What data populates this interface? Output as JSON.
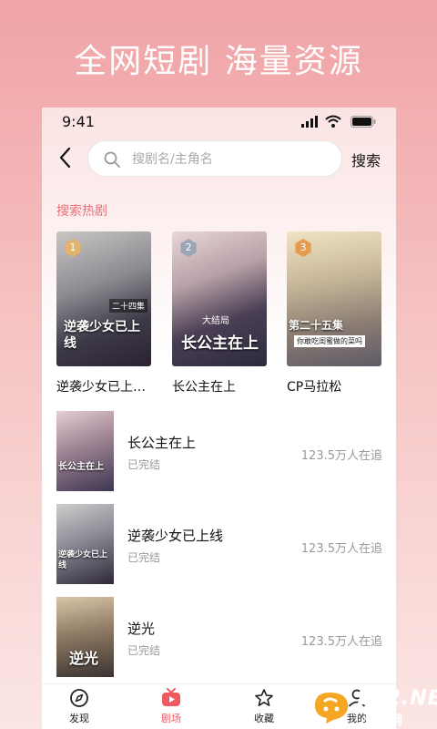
{
  "banner": "全网短剧  海量资源",
  "status": {
    "time": "9:41"
  },
  "search": {
    "placeholder": "搜剧名/主角名",
    "button": "搜索"
  },
  "hot": {
    "title": "搜索热剧",
    "items": [
      {
        "rank": "1",
        "label": "逆袭少女已上…",
        "cover_text": "逆袭少女已上线",
        "cover_small": "二十四集"
      },
      {
        "rank": "2",
        "label": "长公主在上",
        "cover_text": "长公主在上",
        "cover_small": "大结局"
      },
      {
        "rank": "3",
        "label": "CP马拉松",
        "cover_text": "第二十五集",
        "cover_small": "你敢吃闺蜜做的菜吗"
      }
    ],
    "rank_colors": [
      "#e0b46a",
      "#9aa6b6",
      "#e79a52"
    ]
  },
  "list": [
    {
      "title": "长公主在上",
      "status": "已完结",
      "follow": "123.5万人在追",
      "cover_text": "长公主在上"
    },
    {
      "title": "逆袭少女已上线",
      "status": "已完结",
      "follow": "123.5万人在追",
      "cover_text": "逆袭少女已上线"
    },
    {
      "title": "逆光",
      "status": "已完结",
      "follow": "123.5万人在追",
      "cover_text": "逆光"
    }
  ],
  "tabs": [
    {
      "label": "发现",
      "icon": "compass-icon",
      "active": false
    },
    {
      "label": "剧场",
      "icon": "tv-icon",
      "active": true
    },
    {
      "label": "收藏",
      "icon": "star-icon",
      "active": false
    },
    {
      "label": "我的",
      "icon": "user-icon",
      "active": false
    }
  ],
  "watermark": {
    "number": "962.NET",
    "sub": "乐游网"
  },
  "colors": {
    "accent": "#ef5a60",
    "hot_title": "#ef6e75",
    "muted": "#999999"
  }
}
